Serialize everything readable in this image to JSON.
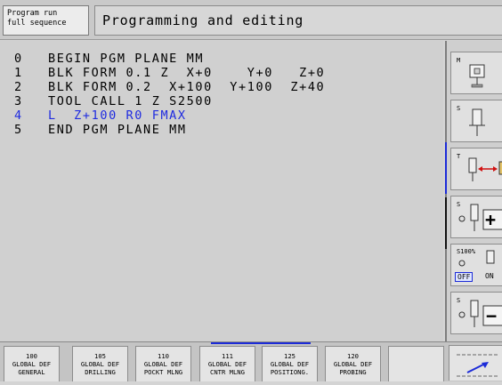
{
  "header": {
    "mode_line1": "Program run",
    "mode_line2": "full sequence",
    "title": "Programming and editing"
  },
  "program": {
    "lines": [
      {
        "n": "0",
        "text": "BEGIN PGM PLANE MM"
      },
      {
        "n": "1",
        "text": "BLK FORM 0.1 Z  X+0    Y+0   Z+0"
      },
      {
        "n": "2",
        "text": "BLK FORM 0.2  X+100  Y+100  Z+40"
      },
      {
        "n": "3",
        "text": "TOOL CALL 1 Z S2500"
      },
      {
        "n": "4",
        "text": "L  Z+100 R0 FMAX"
      },
      {
        "n": "5",
        "text": "END PGM PLANE MM"
      }
    ],
    "active_line": 4
  },
  "right_softkeys": {
    "k1_label": "M",
    "k2_label": "S",
    "k3_label": "T",
    "k4_label": "S",
    "k4_symbol": "+",
    "k5_label": "S100%",
    "k5_off": "OFF",
    "k5_on": "ON",
    "k6_label": "S",
    "k6_symbol": "−"
  },
  "bottom_softkeys": [
    {
      "num": "100",
      "l1": "GLOBAL DEF",
      "l2": "GENERAL"
    },
    {
      "num": "105",
      "l1": "GLOBAL DEF",
      "l2": "DRILLING"
    },
    {
      "num": "110",
      "l1": "GLOBAL DEF",
      "l2": "POCKT MLNG"
    },
    {
      "num": "111",
      "l1": "GLOBAL DEF",
      "l2": "CNTR MLNG"
    },
    {
      "num": "125",
      "l1": "GLOBAL DEF",
      "l2": "POSITIONG."
    },
    {
      "num": "120",
      "l1": "GLOBAL DEF",
      "l2": "PROBING"
    }
  ],
  "colors": {
    "active_line": "#1f2be0",
    "accent_blue": "#1c2bd8",
    "arrow_red": "#d01010"
  }
}
